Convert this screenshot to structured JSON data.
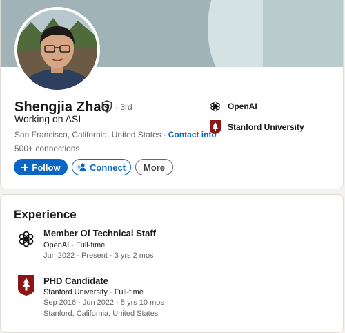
{
  "profile": {
    "name": "Shengjia Zhao",
    "degree": "· 3rd",
    "headline": "Working on ASI",
    "location": "San Francisco, California, United States",
    "separator": "·",
    "contact_info": "Contact info",
    "connections": "500+ connections",
    "buttons": {
      "follow": "Follow",
      "connect": "Connect",
      "more": "More"
    },
    "orgs": [
      {
        "name": "OpenAI",
        "icon": "openai-logo-icon"
      },
      {
        "name": "Stanford University",
        "icon": "stanford-logo-icon"
      }
    ]
  },
  "experience": {
    "title": "Experience",
    "items": [
      {
        "title": "Member Of Technical Staff",
        "company": "OpenAI · Full-time",
        "dates": "Jun 2022 - Present · 3 yrs 2 mos",
        "icon": "openai-logo-icon"
      },
      {
        "title": "PHD Candidate",
        "company": "Stanford University · Full-time",
        "dates": "Sep 2016 - Jun 2022 · 5 yrs 10 mos",
        "location": "Stanford, California, United States",
        "icon": "stanford-logo-icon"
      }
    ]
  },
  "colors": {
    "brand_blue": "#0a66c2",
    "stanford_red": "#8c1515",
    "banner": "#a0b4b7"
  }
}
